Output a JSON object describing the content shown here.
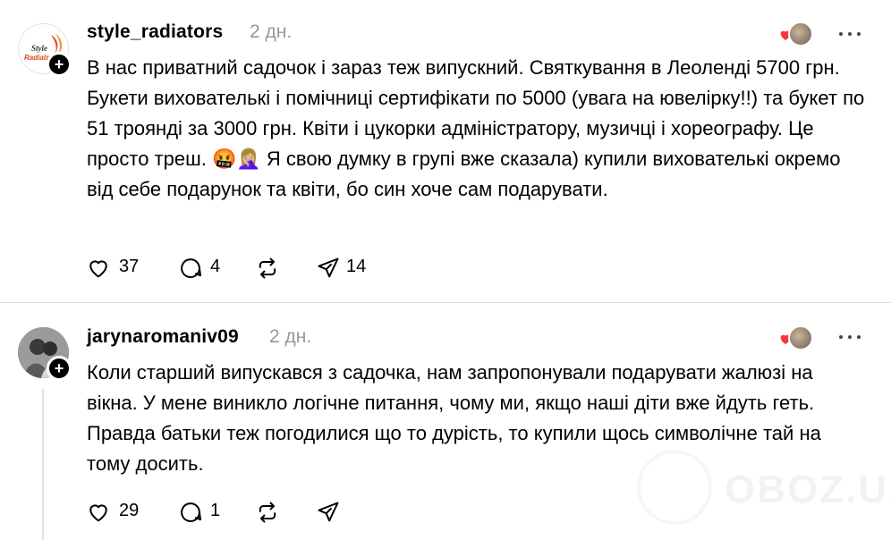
{
  "posts": [
    {
      "username": "style_radiators",
      "time": "2 дн.",
      "avatar_logo_text": "Style Radiatr",
      "body": "В нас приватний садочок і зараз теж випускний. Святкування в Леоленді 5700 грн. Букети вихователькі і помічниці сертифікати по 5000 (увага на ювелірку!!) та букет по 51 троянді за 3000 грн. Квіти і цукорки адміністратору, музичці і хореографу. Це просто треш. 🤬🤦🏼‍♀️ Я свою думку в групі вже сказала) купили вихователькі окремо від себе подарунок та квіти, бо син хоче сам подарувати.",
      "likes": "37",
      "replies": "4",
      "shares": "14"
    },
    {
      "username": "jarynaromaniv09",
      "time": "2 дн.",
      "body": "Коли старший випускався з садочка, нам запропонували подарувати жалюзі на вікна. У мене виникло логічне питання, чому ми, якщо наші діти вже йдуть геть. Правда батьки теж погодилися що то дурість, то купили щось символічне тай на тому досить.",
      "likes": "29",
      "replies": "1",
      "shares": ""
    }
  ],
  "watermark": "OBOZ.UA",
  "icons": {
    "like": "heart-outline-icon",
    "reply": "speech-bubble-icon",
    "repost": "repost-arrows-icon",
    "share": "paper-plane-icon",
    "more": "more-horizontal-icon",
    "follow": "plus-icon"
  },
  "colors": {
    "heart_red": "#ff3040",
    "muted_text": "#999999",
    "divider": "#dbdbdb"
  }
}
